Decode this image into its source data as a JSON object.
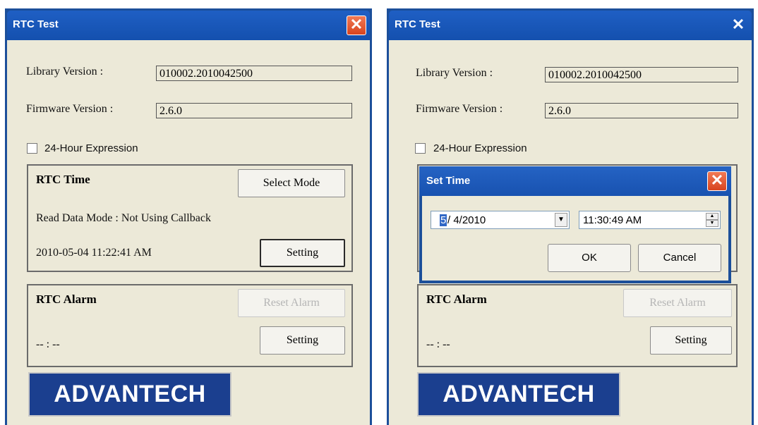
{
  "left": {
    "title": "RTC Test",
    "library_label": "Library Version :",
    "library_value": "010002.2010042500",
    "firmware_label": "Firmware Version :",
    "firmware_value": "2.6.0",
    "hour24_label": "24-Hour Expression",
    "rtc_time_title": "RTC Time",
    "select_mode_label": "Select Mode",
    "read_mode_text": "Read Data Mode : Not Using Callback",
    "datetime_text": "2010-05-04 11:22:41 AM",
    "setting_label": "Setting",
    "rtc_alarm_title": "RTC Alarm",
    "reset_alarm_label": "Reset Alarm",
    "alarm_time": "-- : --",
    "alarm_setting_label": "Setting",
    "logo_text": "ADVANTECH"
  },
  "right": {
    "title": "RTC Test",
    "close_glyph": "✕",
    "library_label": "Library Version :",
    "library_value": "010002.2010042500",
    "firmware_label": "Firmware Version :",
    "firmware_value": "2.6.0",
    "hour24_label": "24-Hour Expression",
    "rtc_alarm_title": "RTC Alarm",
    "reset_alarm_label": "Reset Alarm",
    "alarm_time": "-- : --",
    "alarm_setting_label": "Setting",
    "logo_text": "ADVANTECH"
  },
  "set_time_dialog": {
    "title": "Set Time",
    "date_month_selected": "5",
    "date_rest": "/ 4/2010",
    "time_value": "11:30:49 AM",
    "ok_label": "OK",
    "cancel_label": "Cancel"
  },
  "colors": {
    "titlebar": "#1f5fc4",
    "window_frame": "#1c4f9a",
    "client_bg": "#ece9d8",
    "logo_bg": "#1b3f8f",
    "close_red": "#e0562f"
  }
}
